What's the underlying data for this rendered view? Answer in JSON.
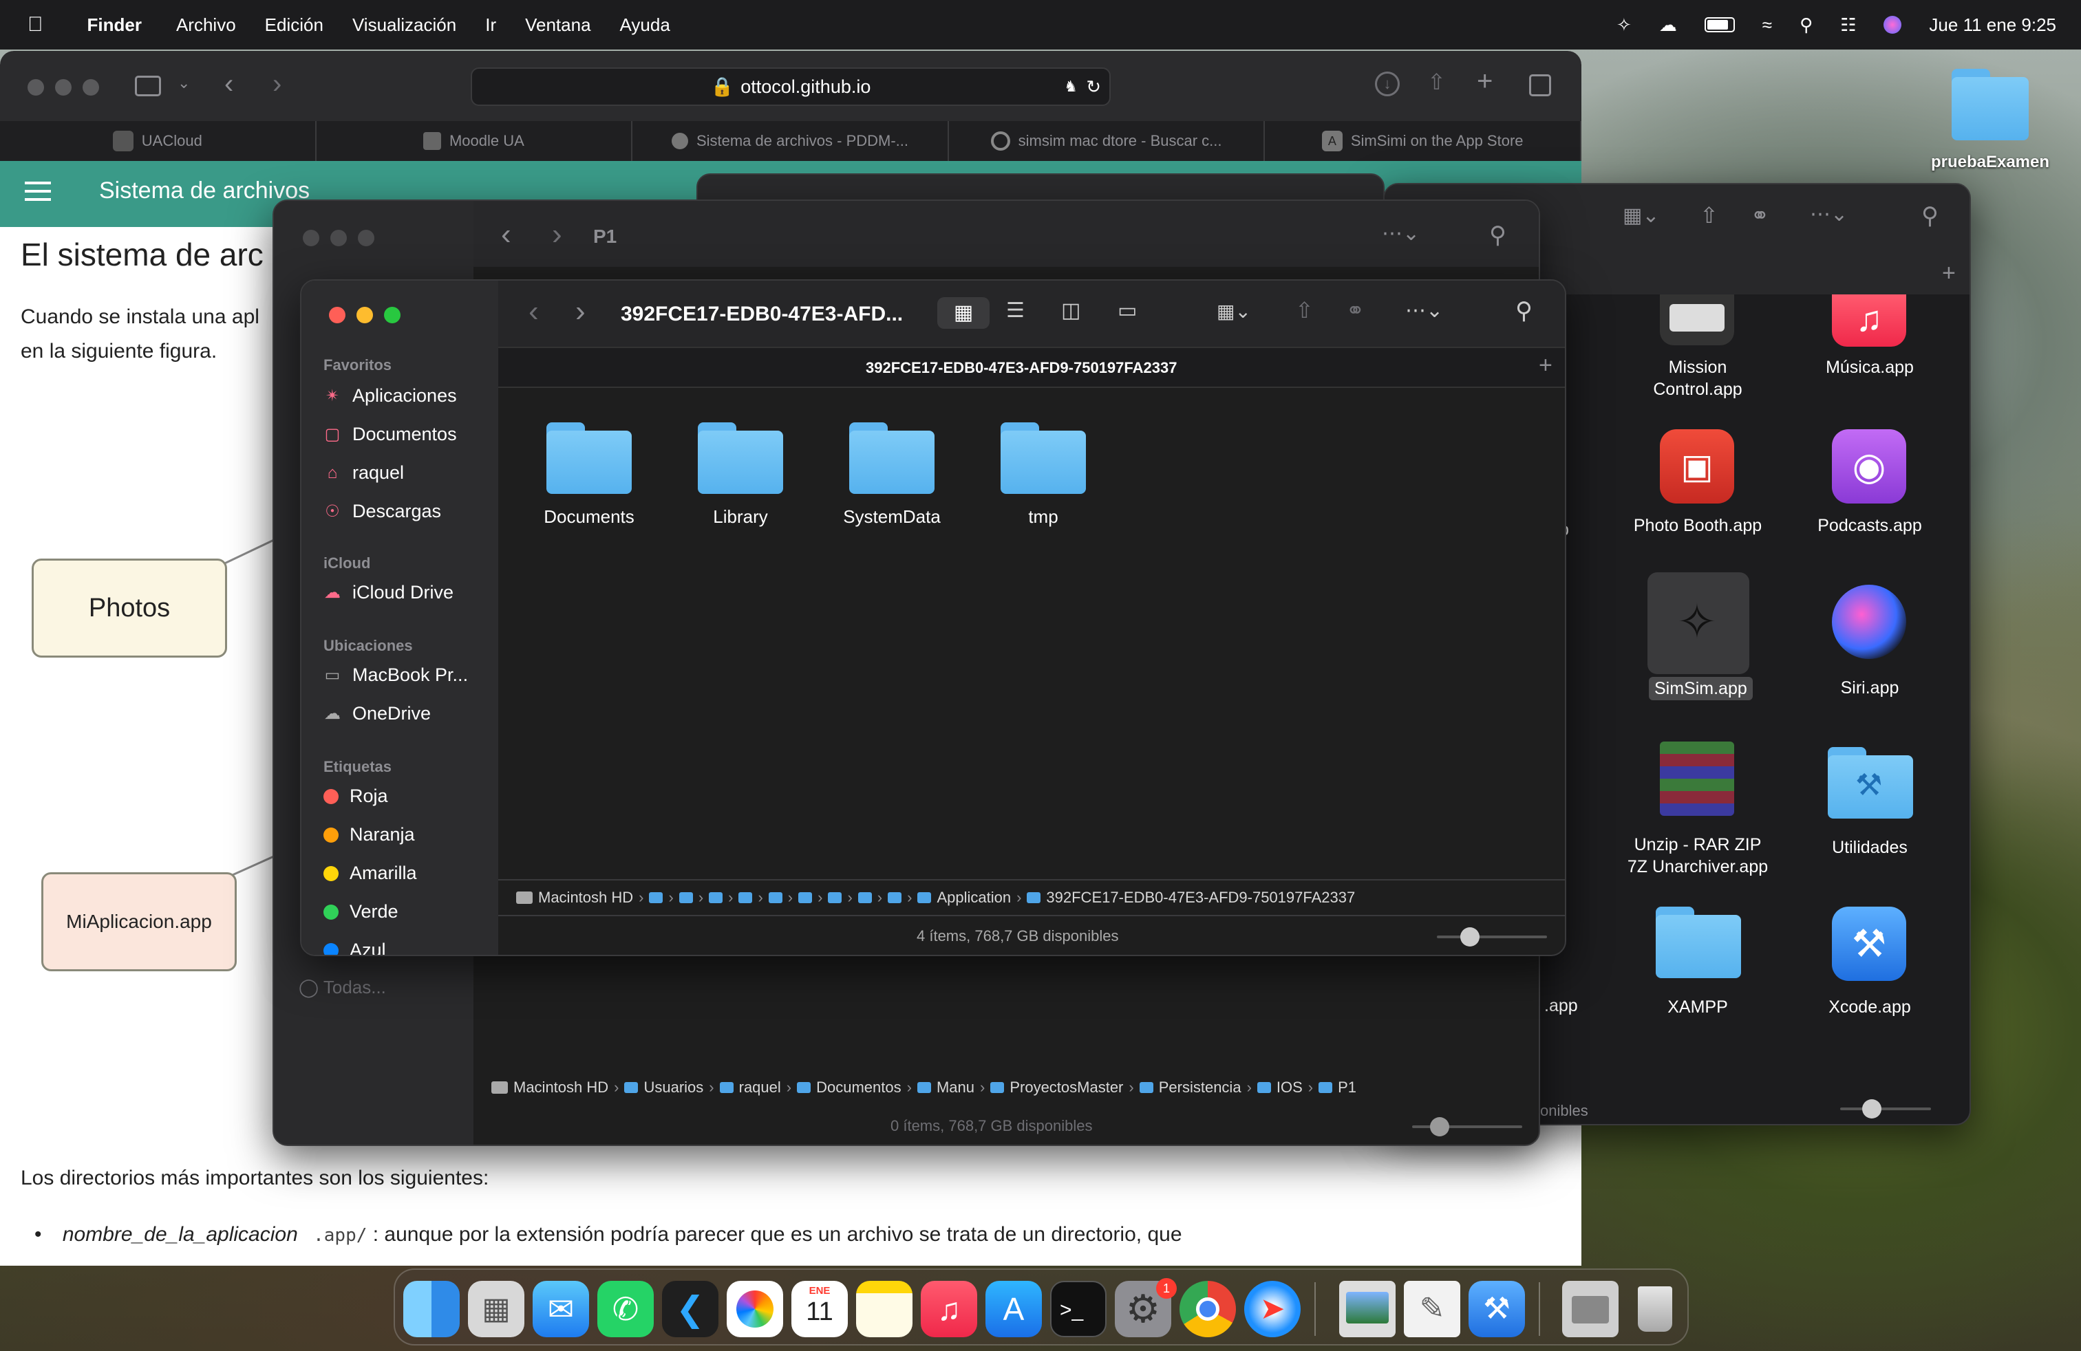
{
  "menubar": {
    "app": "Finder",
    "menus": [
      "Archivo",
      "Edición",
      "Visualización",
      "Ir",
      "Ventana",
      "Ayuda"
    ],
    "clock": "Jue 11 ene 9:25"
  },
  "desktop": {
    "folder_label": "pruebaExamen"
  },
  "safari": {
    "address": "ottocol.github.io",
    "tabs": [
      "UACloud",
      "Moodle UA",
      "Sistema de archivos - PDDM-...",
      "simsim  mac dtore - Buscar c...",
      "SimSimi on the App Store"
    ],
    "site_header": "Sistema de archivos",
    "heading": "El sistema de arc",
    "para1_line1": "Cuando se instala una apl",
    "para1_line2": "en la siguiente figura.",
    "diagram": {
      "photos": "Photos",
      "miapp": "MiAplicacion.app"
    },
    "para2": "Los directorios más importantes son los siguientes:",
    "bullet_em": "nombre_de_la_aplicacion",
    "bullet_code": ".app/",
    "bullet_rest": ": aunque por la extensión podría parecer que es un archivo se trata de un directorio, que"
  },
  "finder_back": {
    "title": "P1",
    "sidebar_extra": "Todas...",
    "path": [
      "Macintosh HD",
      "Usuarios",
      "raquel",
      "Documentos",
      "Manu",
      "ProyectosMaster",
      "Persistencia",
      "IOS",
      "P1"
    ],
    "status": "0 ítems, 768,7 GB disponibles"
  },
  "finder_apps": {
    "apps": [
      {
        "name": "Mission\nControl.app"
      },
      {
        "name": "Música.app"
      },
      {
        "name": "Photo Booth.app"
      },
      {
        "name": "Podcasts.app"
      },
      {
        "name": "SimSim.app"
      },
      {
        "name": "Siri.app"
      },
      {
        "name": "Unzip - RAR ZIP\n7Z Unarchiver.app"
      },
      {
        "name": "Utilidades"
      },
      {
        "name": "XAMPP"
      },
      {
        "name": "Xcode.app"
      }
    ],
    "partial_left": "p",
    "partial_app": ".app",
    "status_partial": "onibles"
  },
  "finder_front": {
    "title": "392FCE17-EDB0-47E3-AFD...",
    "full_title": "392FCE17-EDB0-47E3-AFD9-750197FA2337",
    "sidebar": {
      "favoritos_head": "Favoritos",
      "favoritos": [
        "Aplicaciones",
        "Documentos",
        "raquel",
        "Descargas"
      ],
      "icloud_head": "iCloud",
      "icloud": [
        "iCloud Drive"
      ],
      "ubicaciones_head": "Ubicaciones",
      "ubicaciones": [
        "MacBook Pr...",
        "OneDrive"
      ],
      "etiquetas_head": "Etiquetas",
      "etiquetas": [
        {
          "label": "Roja",
          "color": "#ff5f57"
        },
        {
          "label": "Naranja",
          "color": "#ff9f0a"
        },
        {
          "label": "Amarilla",
          "color": "#ffd60a"
        },
        {
          "label": "Verde",
          "color": "#30d158"
        },
        {
          "label": "Azul",
          "color": "#0a84ff"
        }
      ]
    },
    "folders": [
      "Documents",
      "Library",
      "SystemData",
      "tmp"
    ],
    "path_start": "Macintosh HD",
    "path_app": "Application",
    "path_end": "392FCE17-EDB0-47E3-AFD9-750197FA2337",
    "status": "4 ítems, 768,7 GB disponibles"
  },
  "dock": {
    "calendar_month": "ENE",
    "calendar_day": "11",
    "settings_badge": "1"
  }
}
